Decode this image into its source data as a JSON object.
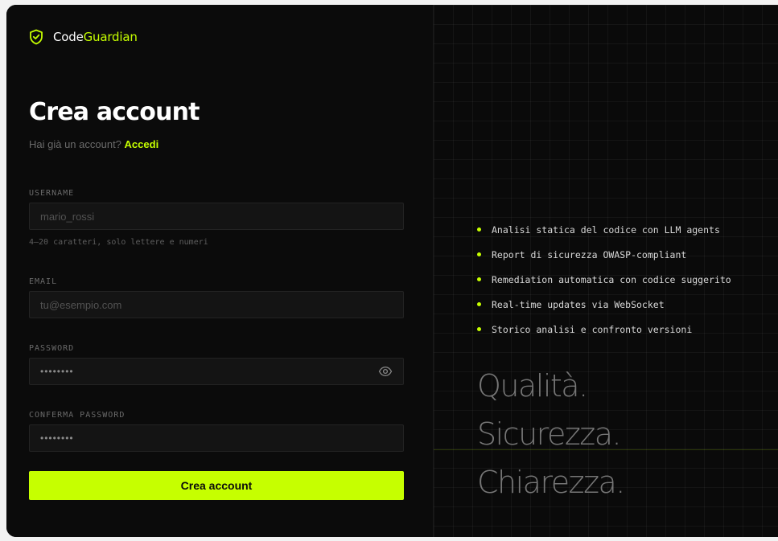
{
  "brand": {
    "name_part1": "Code",
    "name_part2": "Guardian",
    "icon": "shield-check-icon",
    "accent_color": "#c6ff00"
  },
  "form": {
    "title": "Crea account",
    "subtitle_text": "Hai già un account?",
    "login_link": "Accedi",
    "username": {
      "label": "USERNAME",
      "placeholder": "mario_rossi",
      "hint": "4–20 caratteri, solo lettere e numeri"
    },
    "email": {
      "label": "EMAIL",
      "placeholder": "tu@esempio.com"
    },
    "password": {
      "label": "PASSWORD",
      "value": "••••••••",
      "toggle_icon": "eye-icon"
    },
    "confirm_password": {
      "label": "CONFERMA PASSWORD",
      "value": "••••••••"
    },
    "submit_label": "Crea account"
  },
  "features": [
    "Analisi statica del codice con LLM agents",
    "Report di sicurezza OWASP-compliant",
    "Remediation automatica con codice suggerito",
    "Real-time updates via WebSocket",
    "Storico analisi e confronto versioni"
  ],
  "tagline": [
    "Qualità.",
    "Sicurezza.",
    "Chiarezza."
  ]
}
